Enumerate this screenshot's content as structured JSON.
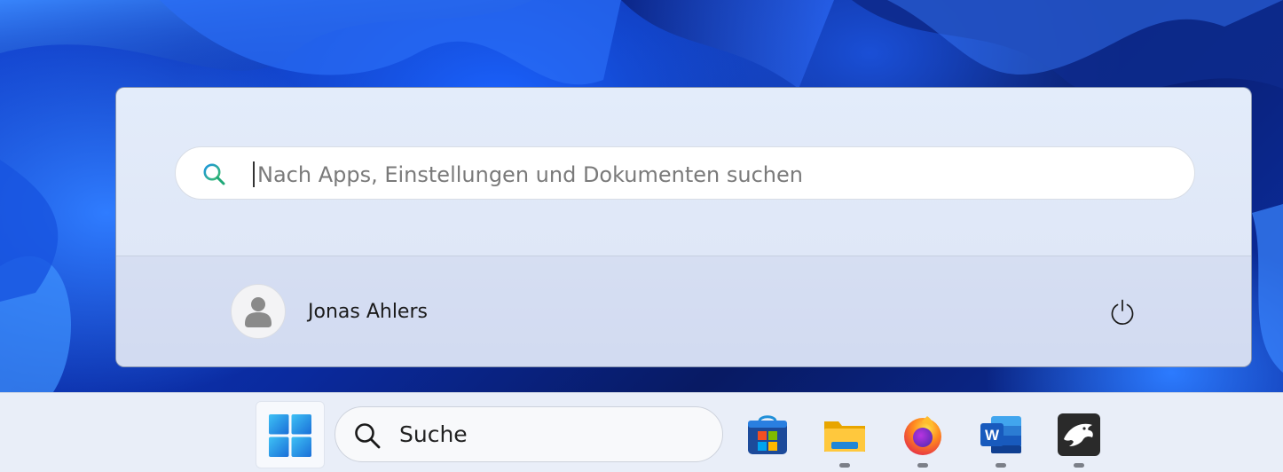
{
  "start_menu": {
    "search": {
      "placeholder": "Nach Apps, Einstellungen und Dokumenten suchen",
      "value": ""
    },
    "user": {
      "name": "Jonas Ahlers"
    },
    "power_icon": "power-icon"
  },
  "taskbar": {
    "start_icon": "windows-logo-icon",
    "search": {
      "label": "Suche",
      "icon": "search-icon"
    },
    "apps": [
      {
        "name": "Microsoft Store",
        "icon": "store-icon",
        "running": false
      },
      {
        "name": "Explorer",
        "icon": "folder-icon",
        "running": true
      },
      {
        "name": "Firefox",
        "icon": "firefox-icon",
        "running": true
      },
      {
        "name": "Word",
        "icon": "word-icon",
        "running": true
      },
      {
        "name": "App",
        "icon": "eagle-icon",
        "running": true
      }
    ]
  },
  "colors": {
    "accent": "#0067c0",
    "search_icon_gradient": [
      "#1fa1d4",
      "#4fc26b"
    ],
    "windows_blue": "#1e8de0"
  }
}
